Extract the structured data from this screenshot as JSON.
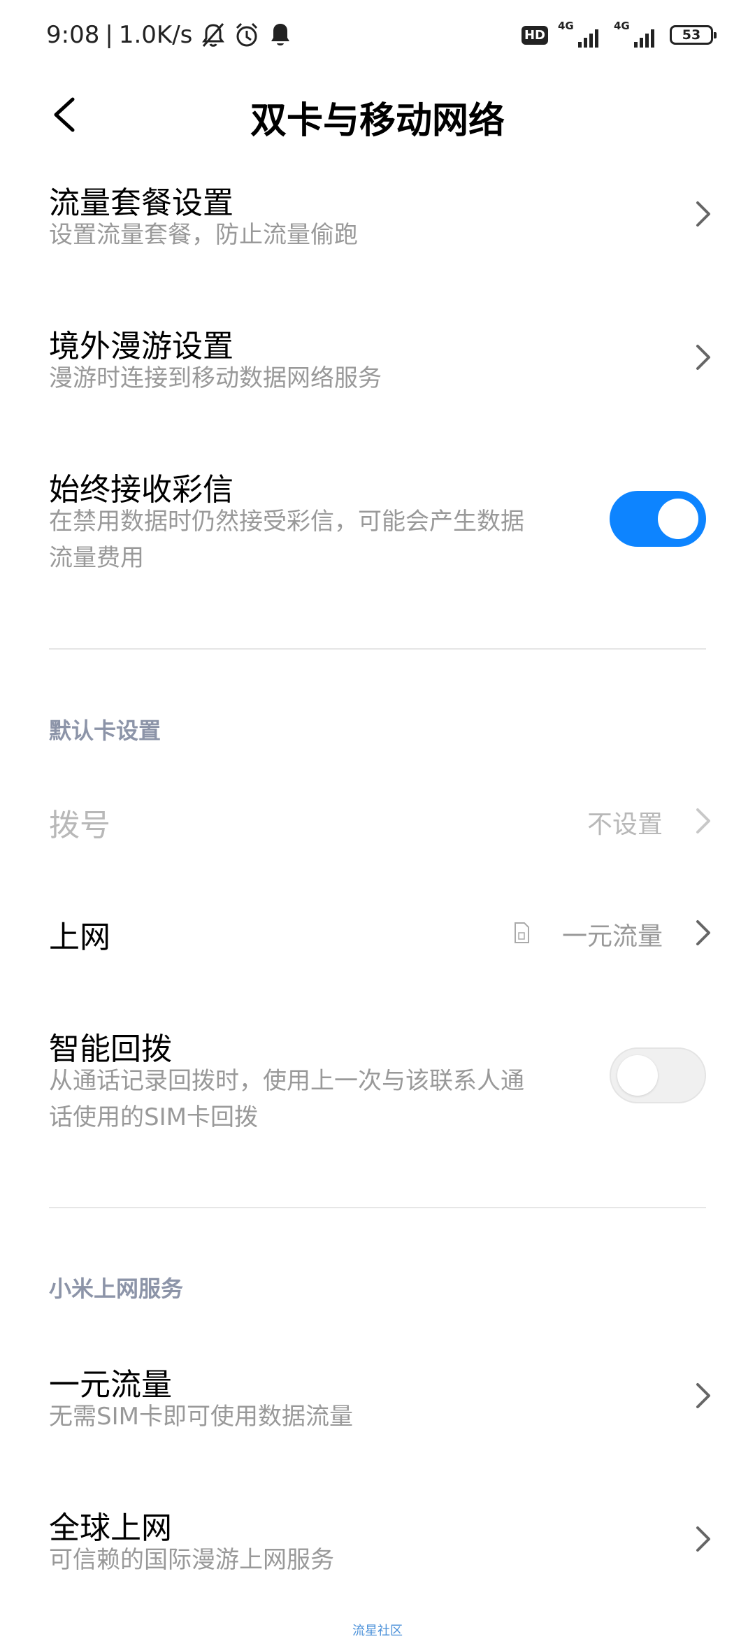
{
  "status_bar": {
    "time": "9:08",
    "separator": "|",
    "speed": "1.0K/s",
    "icons": [
      "bell-off-icon",
      "alarm-icon",
      "bell-icon"
    ],
    "hd_label": "HD",
    "sim1_network": "4G",
    "sim2_network": "4G",
    "battery": "53"
  },
  "header": {
    "title": "双卡与移动网络",
    "back_icon": "chevron-left-icon"
  },
  "settings": {
    "data_plan": {
      "title": "流量套餐设置",
      "subtitle": "设置流量套餐，防止流量偷跑"
    },
    "roaming": {
      "title": "境外漫游设置",
      "subtitle": "漫游时连接到移动数据网络服务"
    },
    "mms": {
      "title": "始终接收彩信",
      "subtitle_line1": "在禁用数据时仍然接受彩信，可能会产生数据",
      "subtitle_line2": "流量费用",
      "enabled": true
    }
  },
  "default_card": {
    "header": "默认卡设置",
    "dial": {
      "title": "拨号",
      "value": "不设置"
    },
    "internet": {
      "title": "上网",
      "value": "一元流量",
      "icon": "sim-card-icon"
    },
    "smart_callback": {
      "title": "智能回拨",
      "subtitle_line1": "从通话记录回拨时，使用上一次与该联系人通",
      "subtitle_line2": "话使用的SIM卡回拨",
      "enabled": false
    }
  },
  "xiaomi_services": {
    "header": "小米上网服务",
    "one_yuan": {
      "title": "一元流量",
      "subtitle": "无需SIM卡即可使用数据流量"
    },
    "global": {
      "title": "全球上网",
      "subtitle": "可信赖的国际漫游上网服务"
    }
  },
  "watermark": "流星社区",
  "colors": {
    "accent": "#0d84ff",
    "section_header": "#8c94a8",
    "secondary_text": "#999999"
  }
}
